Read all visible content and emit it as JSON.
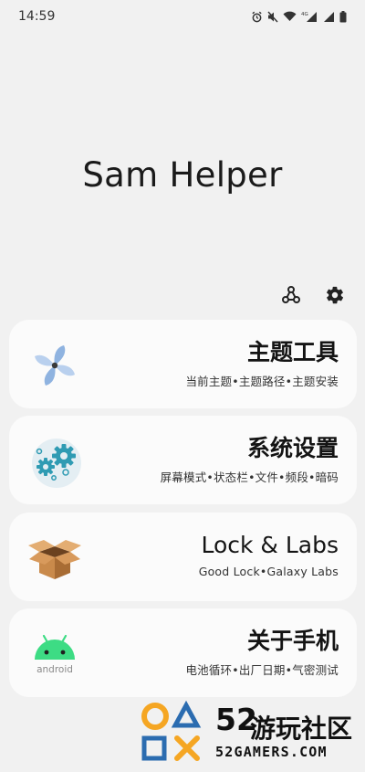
{
  "status": {
    "time": "14:59"
  },
  "app": {
    "title": "Sam Helper"
  },
  "cards": [
    {
      "title": "主题工具",
      "subtitle": "当前主题•主题路径•主题安装",
      "icon": "pinwheel-icon"
    },
    {
      "title": "系统设置",
      "subtitle": "屏幕模式•状态栏•文件•频段•暗码",
      "icon": "gears-icon"
    },
    {
      "title": "Lock & Labs",
      "subtitle": "Good Lock•Galaxy Labs",
      "icon": "box-icon"
    },
    {
      "title": "关于手机",
      "subtitle": "电池循环•出厂日期•气密测试",
      "icon": "android-icon",
      "icon_text": "android"
    }
  ],
  "watermark": {
    "number": "52",
    "name": "游玩社区",
    "url": "52GAMERS.COM"
  },
  "colors": {
    "background": "#f1f1f1",
    "card": "#fbfbfb",
    "android_green": "#3ddc84",
    "gear_teal": "#2f9bb3",
    "box_tan": "#d9a066",
    "watermark_orange": "#f5a623",
    "watermark_blue": "#2b6cb0"
  }
}
